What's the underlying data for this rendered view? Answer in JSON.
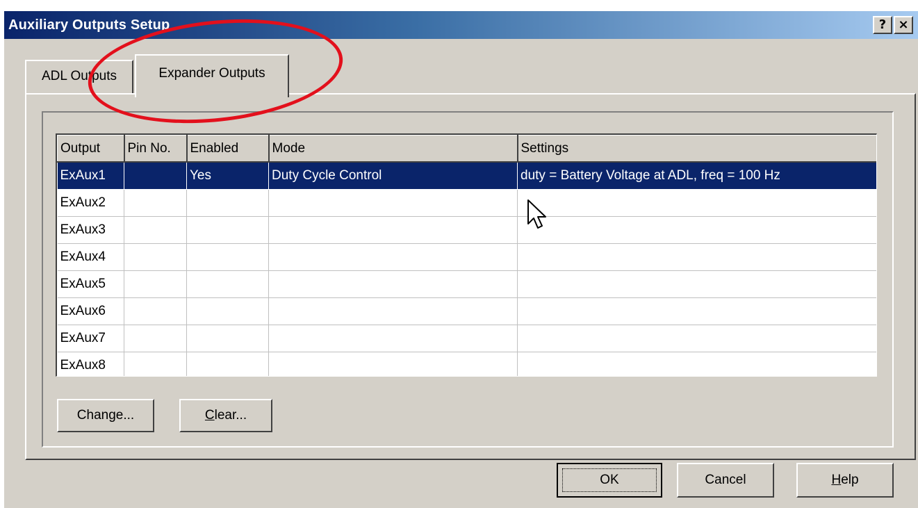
{
  "window": {
    "title": "Auxiliary Outputs Setup",
    "help_button": "?",
    "close_button": "×"
  },
  "tabs": [
    {
      "label": "ADL Outputs",
      "active": false
    },
    {
      "label": "Expander Outputs",
      "active": true
    }
  ],
  "grid": {
    "columns": [
      "Output",
      "Pin No.",
      "Enabled",
      "Mode",
      "Settings"
    ],
    "rows": [
      {
        "output": "ExAux1",
        "pin": "",
        "enabled": "Yes",
        "mode": "Duty Cycle Control",
        "settings": "duty = Battery Voltage at ADL, freq = 100 Hz",
        "selected": true
      },
      {
        "output": "ExAux2",
        "pin": "",
        "enabled": "",
        "mode": "",
        "settings": ""
      },
      {
        "output": "ExAux3",
        "pin": "",
        "enabled": "",
        "mode": "",
        "settings": ""
      },
      {
        "output": "ExAux4",
        "pin": "",
        "enabled": "",
        "mode": "",
        "settings": ""
      },
      {
        "output": "ExAux5",
        "pin": "",
        "enabled": "",
        "mode": "",
        "settings": ""
      },
      {
        "output": "ExAux6",
        "pin": "",
        "enabled": "",
        "mode": "",
        "settings": ""
      },
      {
        "output": "ExAux7",
        "pin": "",
        "enabled": "",
        "mode": "",
        "settings": ""
      },
      {
        "output": "ExAux8",
        "pin": "",
        "enabled": "",
        "mode": "",
        "settings": ""
      }
    ]
  },
  "buttons": {
    "change": "Change...",
    "clear": {
      "accel": "C",
      "rest": "lear..."
    },
    "ok": "OK",
    "cancel": "Cancel",
    "help": {
      "accel": "H",
      "rest": "elp"
    }
  },
  "colors": {
    "selection": "#0a246a",
    "annotation": "#e3101c",
    "dialog_face": "#d4d0c8"
  },
  "icons": [
    "mouse-pointer-icon"
  ]
}
